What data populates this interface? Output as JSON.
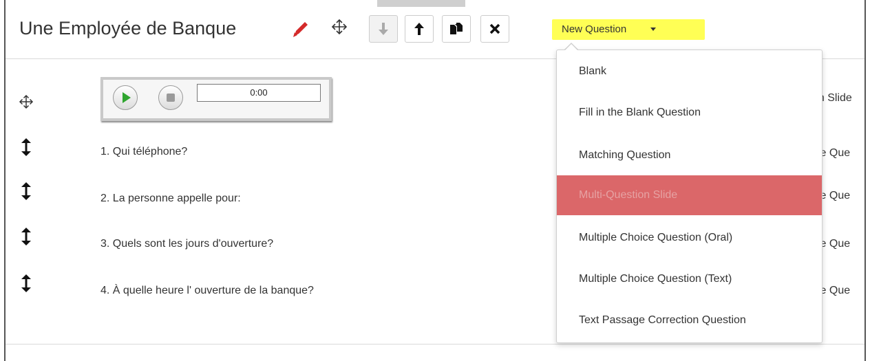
{
  "header": {
    "title": "Une Employée de Banque",
    "new_question_label": "New Question"
  },
  "audio": {
    "time": "0:00"
  },
  "rows": [
    {
      "text": "1. Qui téléphone?",
      "type": "ice Que"
    },
    {
      "text": "2. La personne appelle pour:",
      "type": "ice Que"
    },
    {
      "text": "3. Quels sont les jours d'ouverture?",
      "type": "ice Que"
    },
    {
      "text": "4. À quelle heure l' ouverture de la banque?",
      "type": "ice Que"
    }
  ],
  "audio_row_type": "on Slide",
  "dropdown": {
    "items": [
      {
        "label": "Blank"
      },
      {
        "label": "Fill in the Blank Question"
      },
      {
        "label": "Matching Question"
      },
      {
        "label": "Multi-Question Slide",
        "active": true
      },
      {
        "label": "Multiple Choice Question (Oral)"
      },
      {
        "label": "Multiple Choice Question (Text)"
      },
      {
        "label": "Text Passage Correction Question"
      }
    ]
  },
  "colors": {
    "highlight": "#ffff55",
    "active_item_bg": "#db6769",
    "pencil": "#d42a2a",
    "play_green": "#2fa52f"
  },
  "icons": {
    "edit": "pencil-icon",
    "move": "move-arrows-icon",
    "move_down": "arrow-down-icon",
    "move_up": "arrow-up-icon",
    "copy": "copy-icon",
    "delete": "close-icon",
    "reorder": "vertical-arrows-icon"
  }
}
